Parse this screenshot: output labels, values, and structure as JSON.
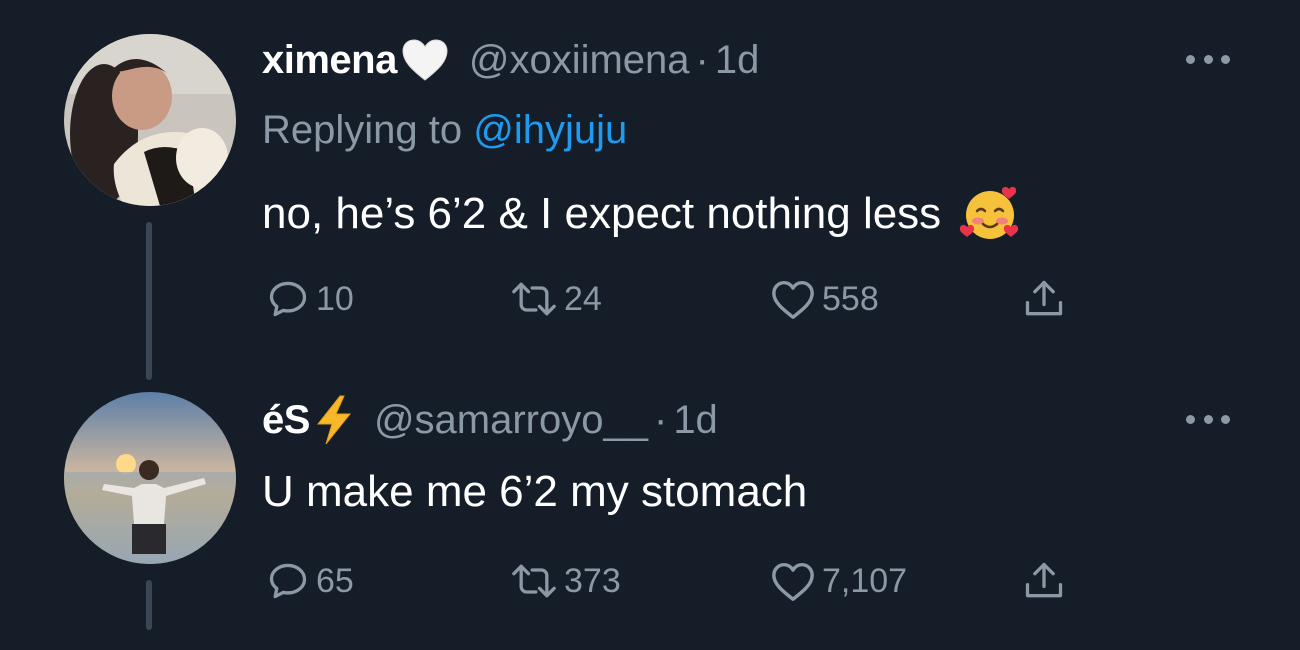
{
  "tweets": [
    {
      "display_name": "ximena",
      "name_emoji": "white-heart",
      "handle": "@xoxiimena",
      "separator": "·",
      "time": "1d",
      "replying_label": "Replying to",
      "replying_to": "@ihyjuju",
      "text": "no, he’s 6’2 & I expect nothing less",
      "text_emoji": "smiling-face-with-hearts",
      "reply_count": "10",
      "retweet_count": "24",
      "like_count": "558"
    },
    {
      "display_name": "éS",
      "name_emoji": "high-voltage",
      "handle": "@samarroyo__",
      "separator": "·",
      "time": "1d",
      "text": "U make me 6’2 my stomach",
      "reply_count": "65",
      "retweet_count": "373",
      "like_count": "7,107"
    }
  ],
  "icons": {
    "reply": "reply-icon",
    "retweet": "retweet-icon",
    "like": "like-icon",
    "share": "share-icon",
    "more": "more-icon"
  },
  "colors": {
    "background": "#151d28",
    "muted": "#8b98a5",
    "link": "#1d9bf0",
    "thread_line": "#3a4654",
    "text": "#ffffff"
  }
}
